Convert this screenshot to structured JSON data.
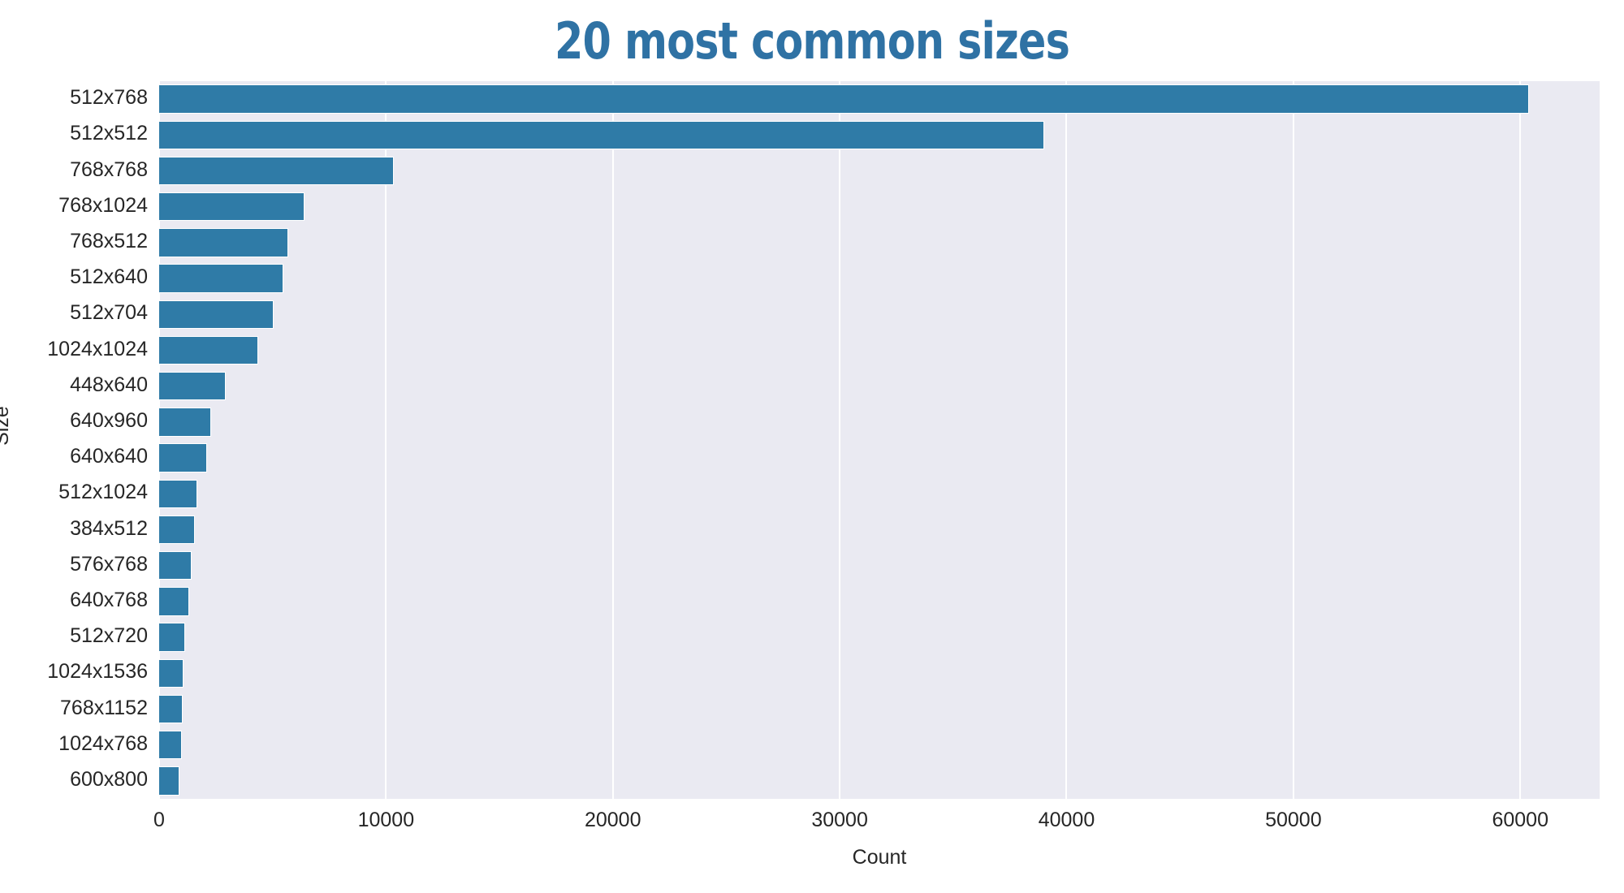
{
  "chart_data": {
    "type": "bar",
    "orientation": "horizontal",
    "title": "20 most common sizes",
    "xlabel": "Count",
    "ylabel": "Size",
    "categories": [
      "512x768",
      "512x512",
      "768x768",
      "768x1024",
      "768x512",
      "512x640",
      "512x704",
      "1024x1024",
      "448x640",
      "640x960",
      "640x640",
      "512x1024",
      "384x512",
      "576x768",
      "640x768",
      "512x720",
      "1024x1536",
      "768x1152",
      "1024x768",
      "600x800"
    ],
    "values": [
      60400,
      39000,
      10350,
      6400,
      5700,
      5480,
      5050,
      4370,
      2940,
      2290,
      2110,
      1680,
      1570,
      1430,
      1320,
      1150,
      1080,
      1040,
      1000,
      900
    ],
    "xlim": [
      0,
      63500
    ],
    "xticks": [
      0,
      10000,
      20000,
      30000,
      40000,
      50000,
      60000
    ],
    "xtick_labels": [
      "0",
      "10000",
      "20000",
      "30000",
      "40000",
      "50000",
      "60000"
    ],
    "grid": true,
    "grid_axis": "x",
    "legend": null,
    "colors": {
      "bar": "#2f7ba7",
      "title": "#2f72a4",
      "plot_background": "#eaeaf2",
      "figure_background": "#ffffff",
      "gridline": "#ffffff",
      "tick_text": "#262626"
    }
  }
}
